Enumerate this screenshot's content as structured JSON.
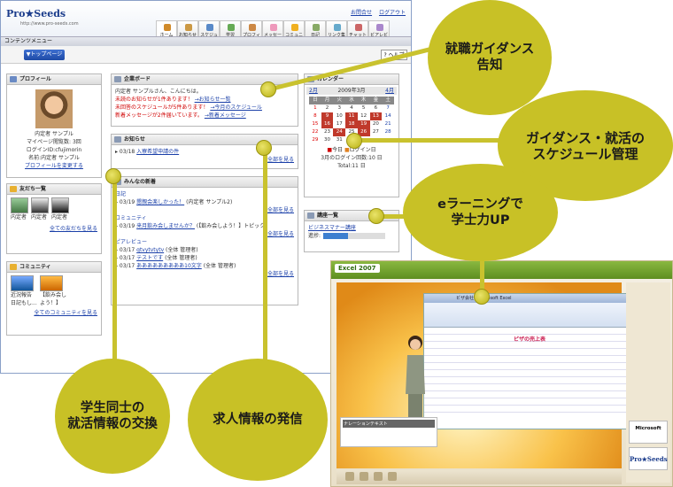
{
  "portal": {
    "logo": "Pro★Seeds",
    "logo_sub": "http://www.pro-seeds.com",
    "toplinks": [
      "お問合せ",
      "ログアウト"
    ],
    "nav": [
      {
        "label": "ホーム",
        "color": "#d08a2a"
      },
      {
        "label": "お知らせ",
        "color": "#c94"
      },
      {
        "label": "スケジュール",
        "color": "#5a8ac8"
      },
      {
        "label": "学習",
        "color": "#6a5"
      },
      {
        "label": "プロフィール",
        "color": "#c84"
      },
      {
        "label": "メッセージ",
        "color": "#e9b"
      },
      {
        "label": "コミュニティ",
        "color": "#f0b020"
      },
      {
        "label": "日記",
        "color": "#8a6"
      },
      {
        "label": "リンク集",
        "color": "#6ac"
      },
      {
        "label": "チャット",
        "color": "#c66"
      },
      {
        "label": "ビアレビュー",
        "color": "#a8c"
      }
    ],
    "menubar": "コンテンツメニュー",
    "top_button": "▼トップページ",
    "help_button": "ヘルプ",
    "profile": {
      "title": "プロフィール",
      "name": "内定者 サンプル",
      "pageviews": "マイページ閲覧数: 3回",
      "login": "ログインID:cfujimorin",
      "fullname": "名前:内定者 サンプル",
      "change": "プロフィールを変更する"
    },
    "friends": {
      "title": "友だち一覧",
      "names": [
        "内定者",
        "内定者",
        "内定者"
      ],
      "more": "全ての友だちを見る"
    },
    "community": {
      "title": "コミュニティ",
      "names": [
        "近況報告 日記もし...",
        "【飲み会しよう！】"
      ],
      "more": "全てのコミュニティを見る"
    },
    "board": {
      "title": "企業ボード",
      "greeting": "内定者 サンプルさん、こんにちは。",
      "lines": [
        {
          "text": "未読のお知らせが1件あります！",
          "link": "→お知らせ一覧"
        },
        {
          "text": "未回答のスケジュールが5件あります！",
          "link": "→今月のスケジュール"
        },
        {
          "text": "新着メッセージが2件届いています。",
          "link": "→新着メッセージ"
        }
      ]
    },
    "news": {
      "title": "お知らせ",
      "items": [
        {
          "date": "03/18",
          "link": "入寮希望申請の件"
        }
      ],
      "more": "全部を見る"
    },
    "updates": {
      "title": "みんなの新着",
      "sections": [
        {
          "label": "日記",
          "items": [
            {
              "date": "03/19",
              "link": "懇親会楽しかった！",
              "by": "(内定者 サンプル2)"
            }
          ]
        },
        {
          "label": "コミュニティ",
          "items": [
            {
              "date": "03/19",
              "link": "来月飲み会しませんか？",
              "by": "(【飲み会しよう！】トピック)"
            }
          ]
        },
        {
          "label": "ピアレビュー",
          "items": [
            {
              "date": "03/17",
              "link": "qtvytvtytv",
              "by": "(全体 管理者)"
            },
            {
              "date": "03/17",
              "link": "テストです",
              "by": "(全体 管理者)"
            },
            {
              "date": "03/17",
              "link": "あああああああああ10文字",
              "by": "(全体 管理者)"
            }
          ]
        }
      ],
      "more": "全部を見る"
    },
    "calendar": {
      "title": "カレンダー",
      "prev": "2月",
      "current": "2009年3月",
      "next": "4月",
      "weekdays": [
        "日",
        "月",
        "火",
        "水",
        "木",
        "金",
        "土"
      ],
      "weeks": [
        [
          "1",
          "2",
          "3",
          "4",
          "5",
          "6",
          "7"
        ],
        [
          "8",
          "9",
          "10",
          "11",
          "12",
          "13",
          "14"
        ],
        [
          "15",
          "16",
          "17",
          "18",
          "19",
          "20",
          "21"
        ],
        [
          "22",
          "23",
          "24",
          "25",
          "26",
          "27",
          "28"
        ],
        [
          "29",
          "30",
          "31",
          "",
          "",
          "",
          ""
        ]
      ],
      "legend_today": "今日",
      "legend_login": "ログイン日",
      "login_count": "3月のログイン回数:10 日",
      "total": "Total:11 日"
    },
    "courses": {
      "title": "講座一覧",
      "link": "ビジネスマナー講座",
      "progress_label": "進捗:",
      "progress": 0.4
    }
  },
  "elearn": {
    "title": "Excel 2007",
    "excel_title": "ビザ会社 - Microsoft Excel",
    "sheet_title": "ピザの売上表",
    "narration_title": "ナレーションテキスト",
    "ms_label": "Microsoft",
    "ps_label": "Pro★Seeds"
  },
  "callouts": [
    {
      "text": "就職ガイダンス\n告知"
    },
    {
      "text": "ガイダンス・就活の\nスケジュール管理"
    },
    {
      "text": "eラーニングで\n学士力UP"
    },
    {
      "text": "学生同士の\n就活情報の交換"
    },
    {
      "text": "求人情報の発信"
    }
  ]
}
